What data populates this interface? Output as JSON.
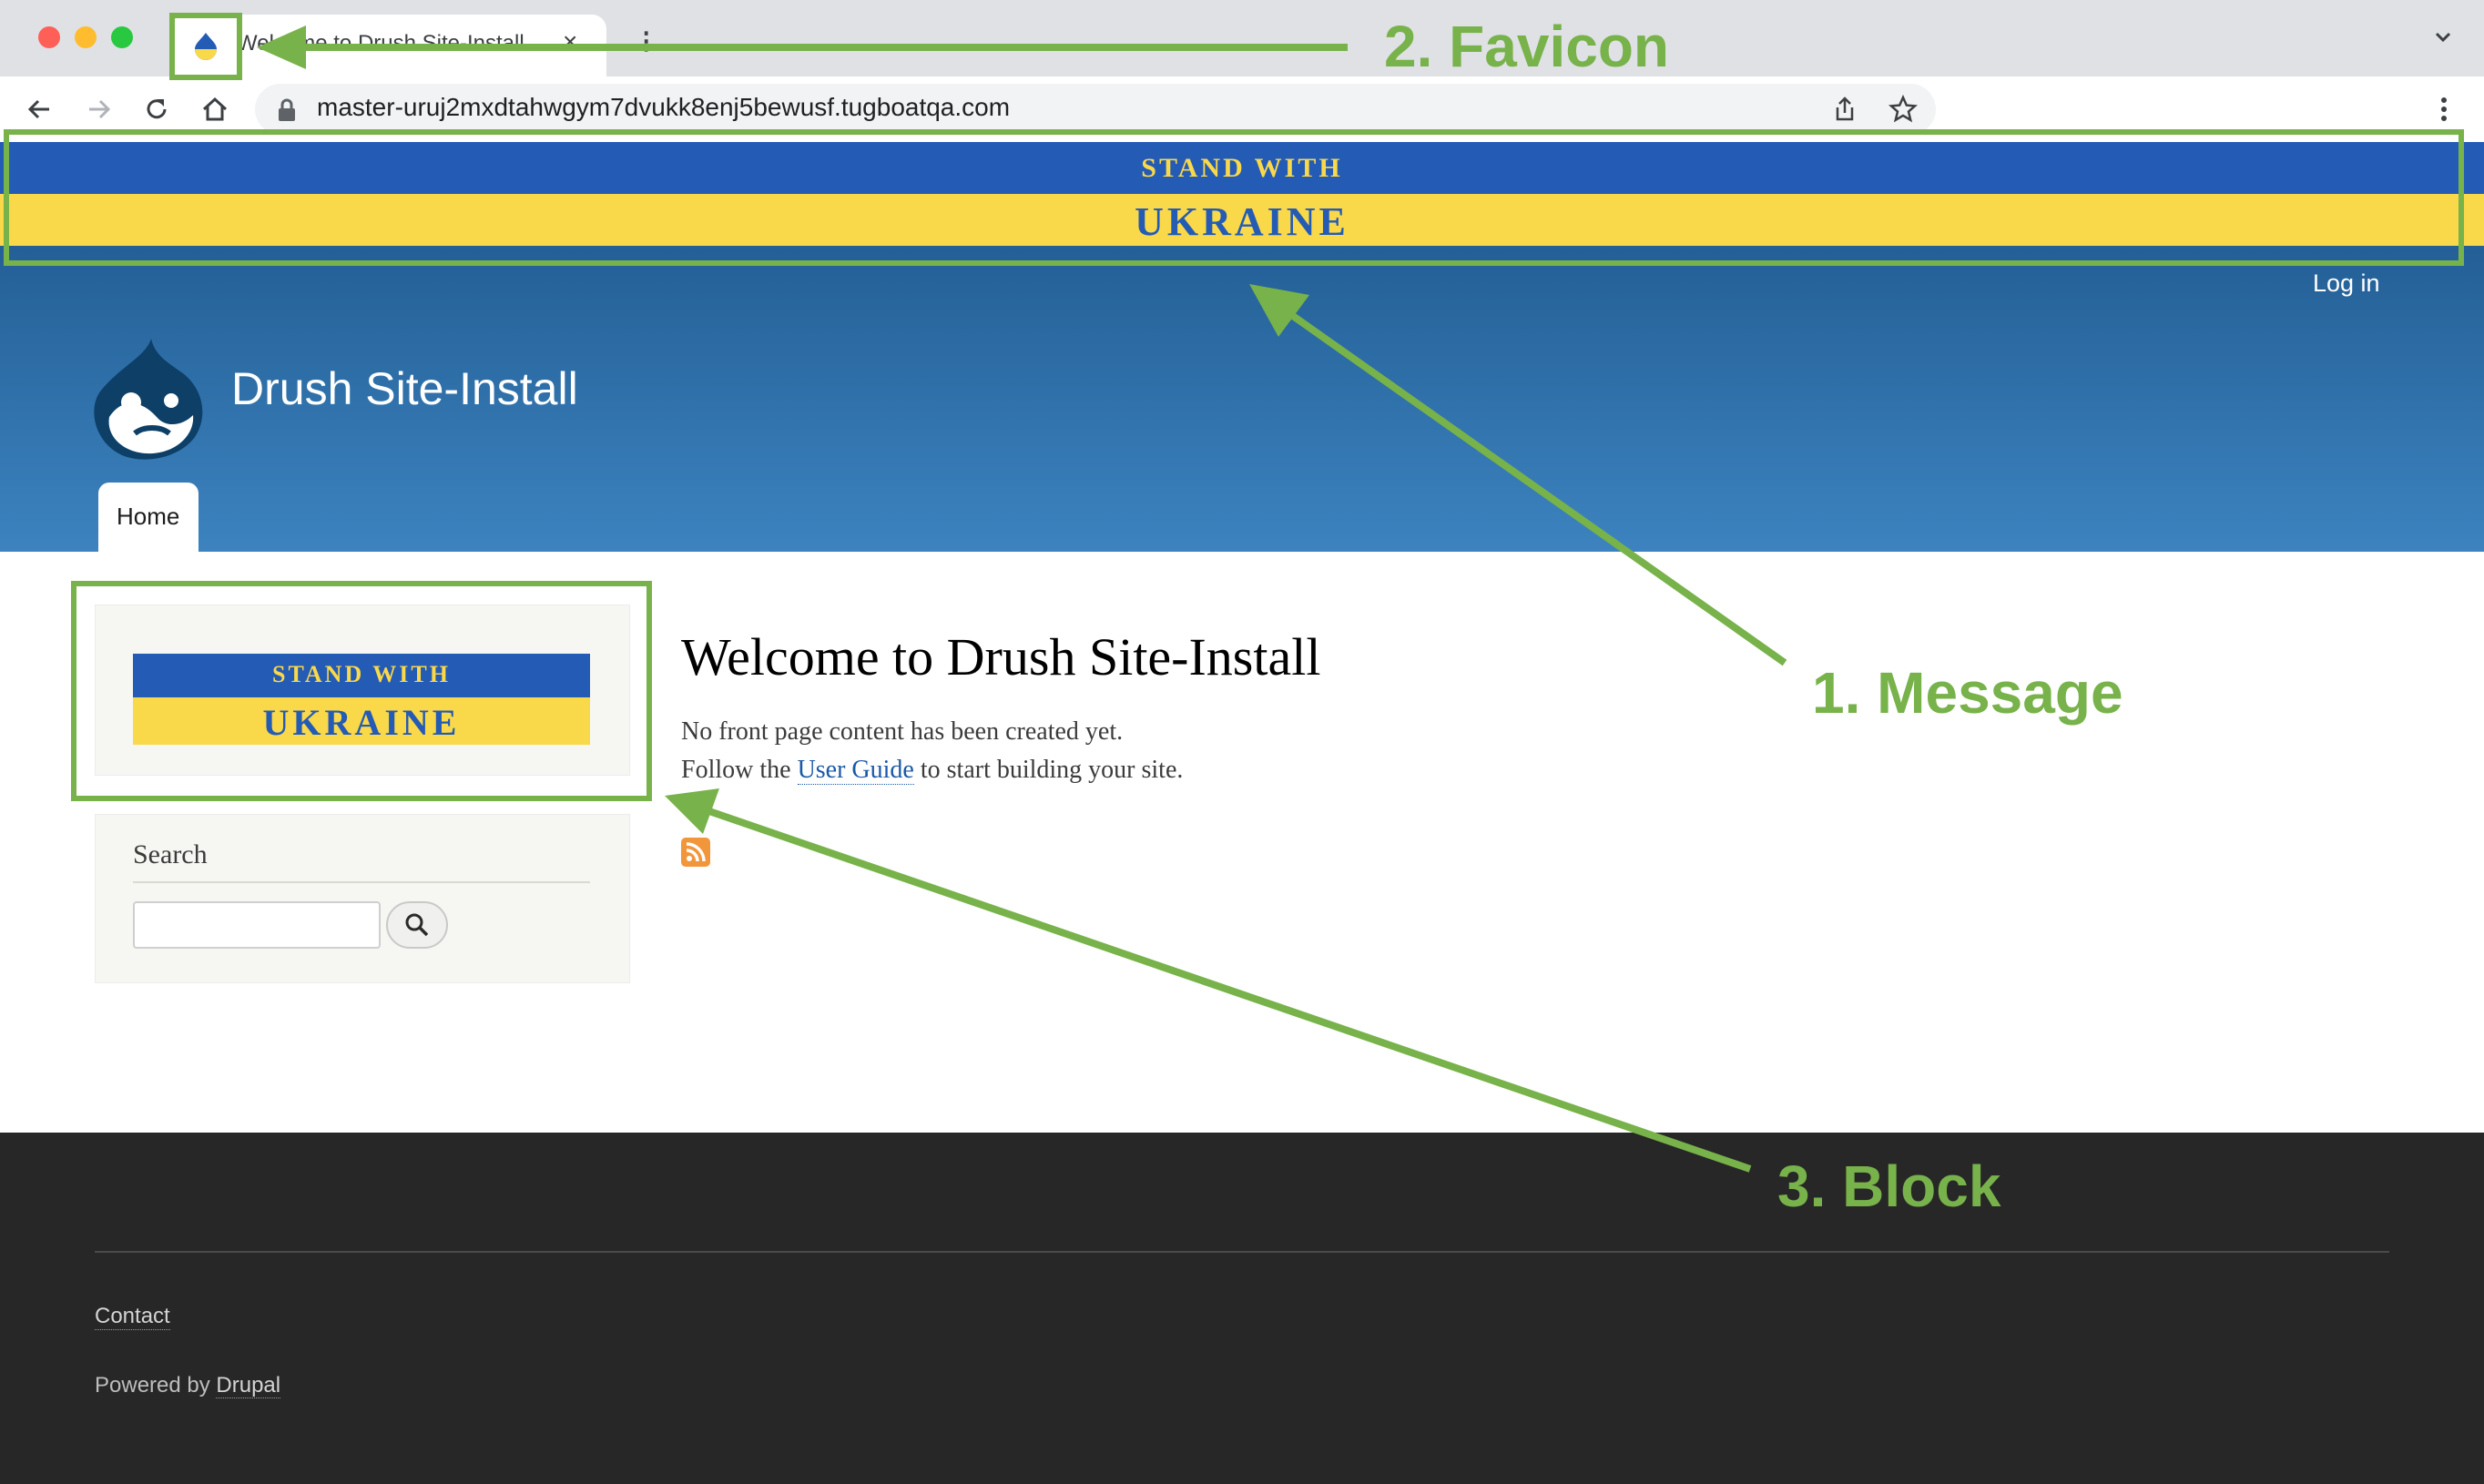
{
  "browser": {
    "tab_title": "Welcome to Drush Site-Install",
    "tab_close": "×",
    "url": "master-uruj2mxdtahwgym7dvukk8enj5bewusf.tugboatqa.com"
  },
  "message_banner": {
    "line1": "STAND WITH",
    "line2": "UKRAINE",
    "colors": {
      "blue": "#245bb5",
      "yellow": "#f9d84a"
    }
  },
  "header": {
    "login_link": "Log in",
    "site_name": "Drush Site-Install",
    "logo_icon": "drupal-drop-icon",
    "nav": [
      {
        "label": "Home",
        "active": true
      }
    ]
  },
  "sidebar": {
    "ukraine_block": {
      "line1": "STAND WITH",
      "line2": "UKRAINE"
    },
    "search": {
      "title": "Search",
      "input_value": "",
      "button_icon": "search-icon"
    }
  },
  "main": {
    "title": "Welcome to Drush Site-Install",
    "line1": "No front page content has been created yet.",
    "line2_prefix": "Follow the ",
    "line2_link": "User Guide",
    "line2_suffix": " to start building your site.",
    "feed_icon": "rss-icon"
  },
  "footer": {
    "contact_link": "Contact",
    "powered_by_prefix": "Powered by ",
    "powered_by_link": "Drupal"
  },
  "annotations": {
    "color": "#78b24a",
    "favicon_label": "2. Favicon",
    "message_label": "1. Message",
    "block_label": "3. Block"
  }
}
